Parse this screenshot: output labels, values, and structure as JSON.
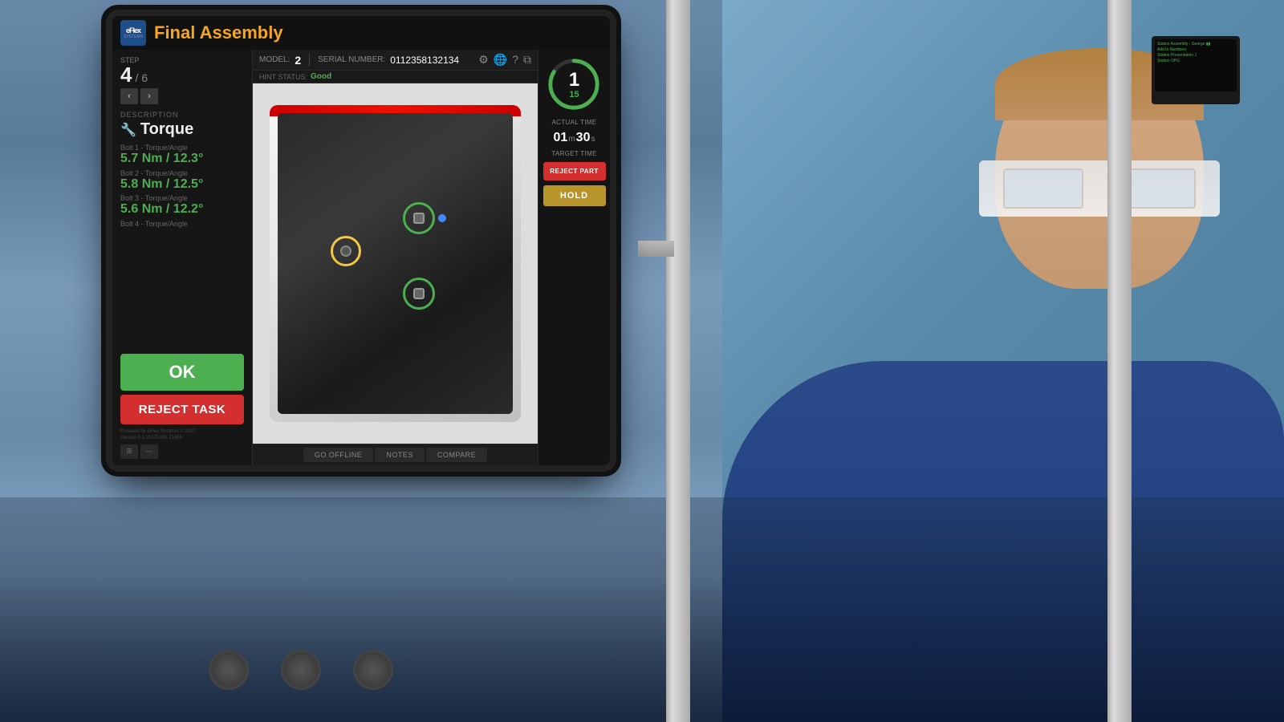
{
  "app": {
    "logo_top": "eFlex",
    "logo_bottom": "SYSTEMS",
    "title": "Final Assembly"
  },
  "header": {
    "model_label": "MODEL:",
    "model_value": "2",
    "serial_label": "SERIAL NUMBER:",
    "serial_value": "0112358132134",
    "hint_label": "HINT STATUS:",
    "hint_value": "Good"
  },
  "left_panel": {
    "step_label": "STEP",
    "step_current": "4",
    "step_separator": "/",
    "step_total": "6",
    "desc_label": "DESCRIPTION",
    "desc_value": "Torque",
    "bolt1_label": "Bolt 1 - Torque/Angle",
    "bolt1_value": "5.7 Nm / 12.3°",
    "bolt2_label": "Bolt 2 - Torque/Angle",
    "bolt2_value": "5.8 Nm / 12.5°",
    "bolt3_label": "Bolt 3 - Torque/Angle",
    "bolt3_value": "5.6 Nm / 12.2°",
    "bolt4_label": "Bolt 4 - Torque/Angle",
    "ok_button": "OK",
    "reject_task_button": "REJECT TASK",
    "footer_text": "Powered by eFlex Systems © 2017",
    "footer_version": "Version 5.1.20171000-21455"
  },
  "status_panel": {
    "timer_number": "1",
    "timer_superscript": "15",
    "actual_time_label": "ACTUAL TIME",
    "target_min": "01",
    "target_min_unit": "m",
    "target_sec": "30",
    "target_sec_unit": "s",
    "target_time_label": "TARGET TIME",
    "reject_part_button": "REJECT PART",
    "hold_button": "HOLD"
  },
  "bottom_bar": {
    "go_offline_btn": "GO OFFLINE",
    "notes_btn": "NOTES",
    "compare_btn": "COMPARE"
  },
  "icons": {
    "wrench": "🔧",
    "settings": "⚙",
    "globe": "🌐",
    "help": "?",
    "window": "⧉",
    "nav_prev": "‹",
    "nav_next": "›",
    "grid": "⊞",
    "fullscreen": "⛶"
  }
}
